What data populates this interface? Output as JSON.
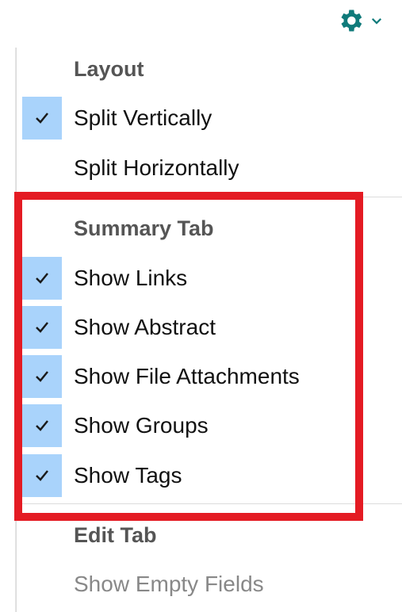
{
  "toolbar": {
    "gear_icon": "gear-icon",
    "chevron_icon": "chevron-down-icon",
    "accent_color": "#0f7a7a"
  },
  "menu": {
    "layout_header": "Layout",
    "layout_items": [
      {
        "label": "Split Vertically",
        "checked": true
      },
      {
        "label": "Split Horizontally",
        "checked": false
      }
    ],
    "summary_header": "Summary Tab",
    "summary_items": [
      {
        "label": "Show Links",
        "checked": true
      },
      {
        "label": "Show Abstract",
        "checked": true
      },
      {
        "label": "Show File Attachments",
        "checked": true
      },
      {
        "label": "Show Groups",
        "checked": true
      },
      {
        "label": "Show Tags",
        "checked": true
      }
    ],
    "edit_header": "Edit Tab",
    "edit_items": [
      {
        "label": "Show Empty Fields",
        "checked": false,
        "disabled": true
      }
    ]
  },
  "colors": {
    "check_bg": "#a9d3fb",
    "highlight": "#e41b23"
  }
}
